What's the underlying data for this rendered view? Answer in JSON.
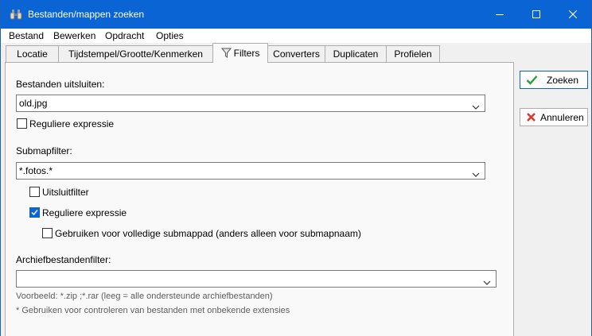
{
  "window": {
    "title": "Bestanden/mappen zoeken",
    "accent": "#0a64d3"
  },
  "menu": {
    "items": [
      "Bestand",
      "Bewerken",
      "Opdracht",
      "Opties"
    ]
  },
  "tabs": [
    {
      "label": "Locatie",
      "active": false
    },
    {
      "label": "Tijdstempel/Grootte/Kenmerken",
      "active": false
    },
    {
      "label": "Filters",
      "active": true,
      "icon": "filter-icon"
    },
    {
      "label": "Converters",
      "active": false
    },
    {
      "label": "Duplicaten",
      "active": false
    },
    {
      "label": "Profielen",
      "active": false
    }
  ],
  "filters": {
    "exclude_label": "Bestanden uitsluiten:",
    "exclude_value": "old.jpg",
    "exclude_regex_label": "Reguliere expressie",
    "exclude_regex_checked": false,
    "subfolder_label": "Submapfilter:",
    "subfolder_value": "*.fotos.*",
    "exclude_filter_label": "Uitsluitfilter",
    "exclude_filter_checked": false,
    "subfolder_regex_label": "Reguliere expressie",
    "subfolder_regex_checked": true,
    "full_path_label": "Gebruiken voor volledige submappad (anders alleen voor submapnaam)",
    "full_path_checked": false,
    "archive_label": "Archiefbestandenfilter:",
    "archive_value": "",
    "archive_hint": "Voorbeeld: *.zip ;*.rar (leeg = alle ondersteunde archiefbestanden)",
    "archive_note": "* Gebruiken voor controleren van bestanden met onbekende extensies"
  },
  "actions": {
    "search_label": "Zoeken",
    "cancel_label": "Annuleren"
  }
}
